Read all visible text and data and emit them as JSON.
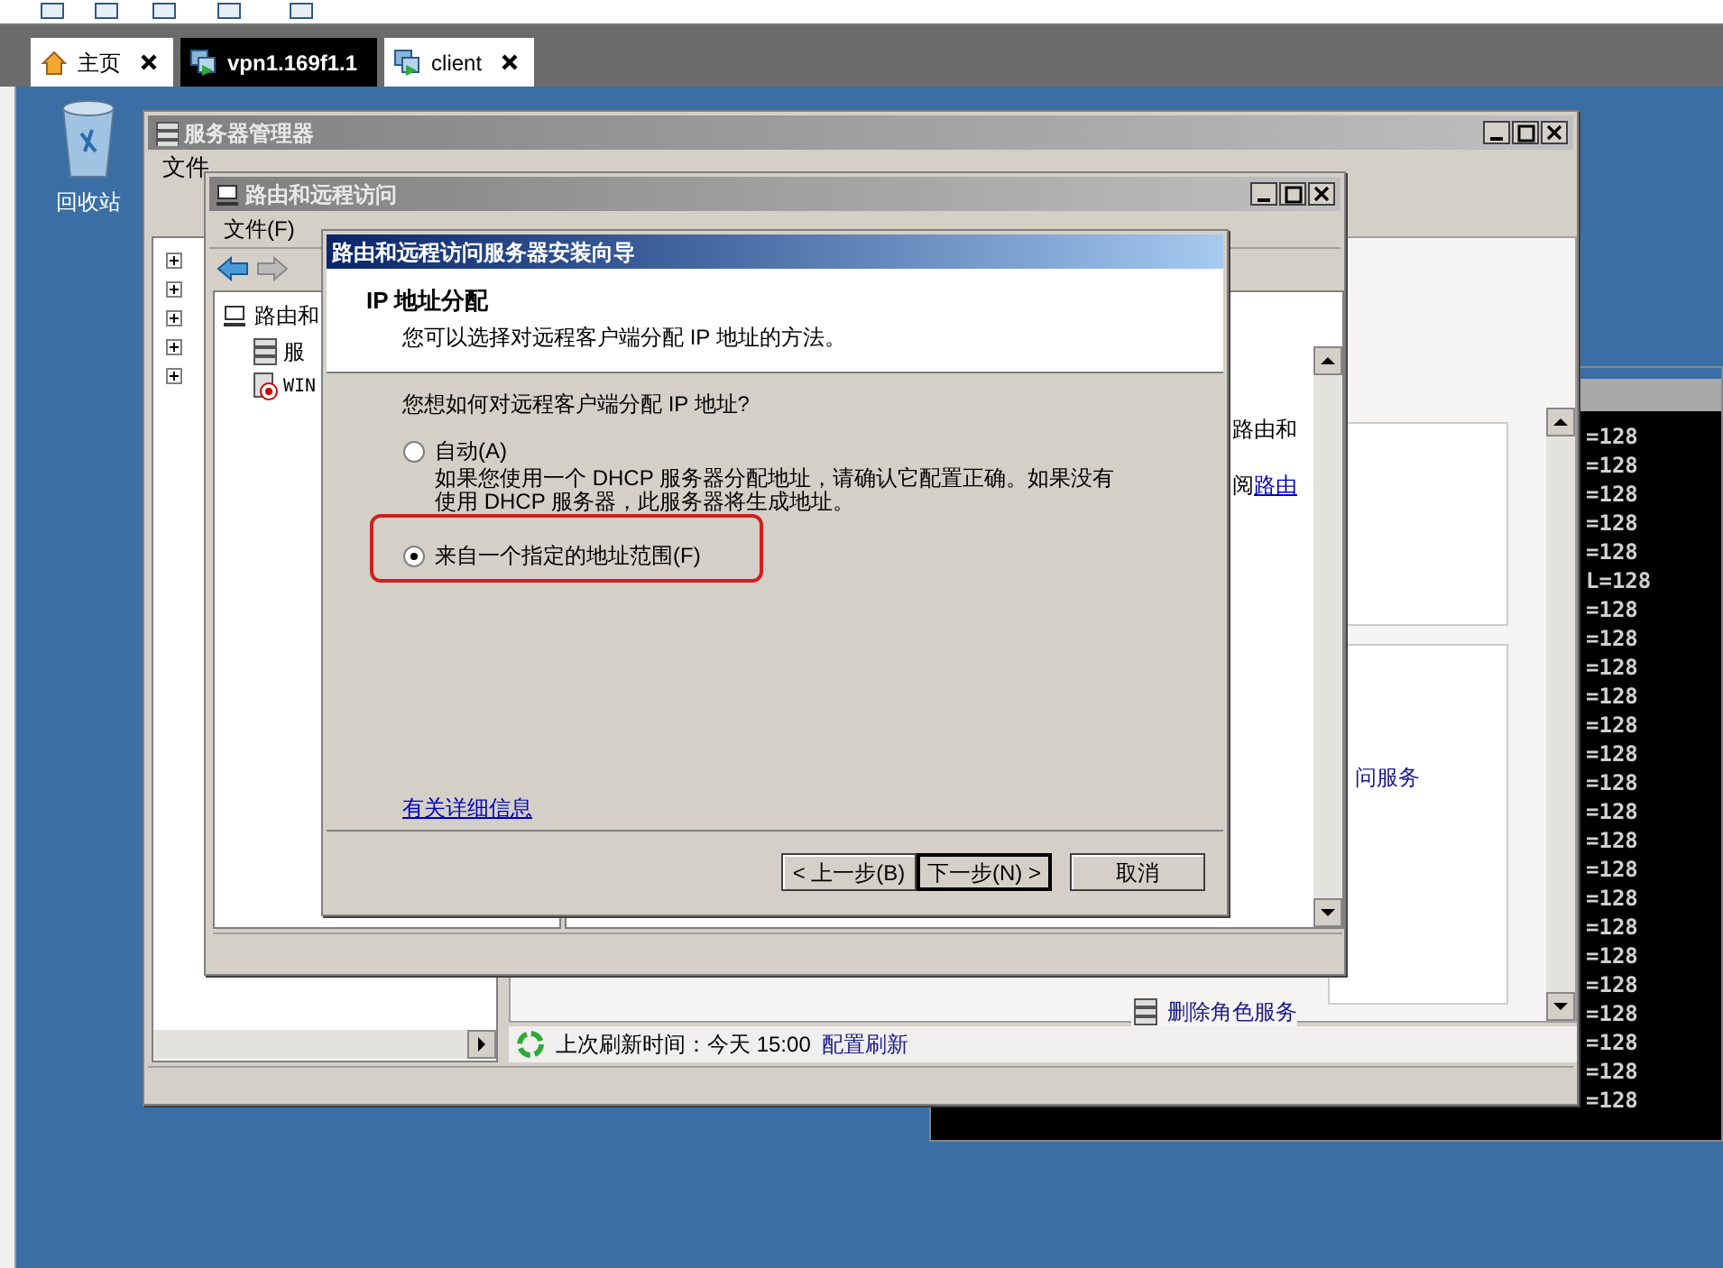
{
  "vm_tabs": [
    {
      "label": "主页",
      "kind": "home",
      "selected": false,
      "closable": true
    },
    {
      "label": "vpn1.169f1.1",
      "kind": "vm",
      "selected": true,
      "closable": false
    },
    {
      "label": "client",
      "kind": "vm",
      "selected": false,
      "closable": true
    }
  ],
  "desktop": {
    "icons": [
      {
        "label": "回收站"
      }
    ]
  },
  "console": {
    "lines": [
      "=128",
      "=128",
      "=128",
      "=128",
      "=128",
      "L=128",
      "=128",
      "=128",
      "=128",
      "=128",
      "=128",
      "=128",
      "=128",
      "=128",
      "=128",
      "=128",
      "=128",
      "=128",
      "=128",
      "=128",
      "=128",
      "=128",
      "=128",
      "=128"
    ]
  },
  "server_manager": {
    "title": "服务器管理器",
    "menu": [
      "文件"
    ],
    "link_text": "问服务",
    "role_action": "删除角色服务",
    "status": {
      "text": "上次刷新时间：今天 15:00",
      "link": "配置刷新"
    }
  },
  "rras": {
    "title": "路由和远程访问",
    "menu": [
      "文件(F)"
    ],
    "tree": [
      {
        "label": "路由和",
        "children": [
          {
            "label": "服",
            "kind": "server"
          },
          {
            "label": "WIN",
            "kind": "server-error"
          }
        ]
      }
    ],
    "pane_text": "路由和",
    "pane_text_2": "阅",
    "pane_link": "路由"
  },
  "wizard": {
    "title": "路由和远程访问服务器安装向导",
    "heading": "IP 地址分配",
    "subheading": "您可以选择对远程客户端分配 IP 地址的方法。",
    "question": "您想如何对远程客户端分配 IP 地址?",
    "options": [
      {
        "label": "自动(A)",
        "selected": false,
        "annotated": false,
        "description": "如果您使用一个 DHCP 服务器分配地址，请确认它配置正确。如果没有使用 DHCP 服务器，此服务器将生成地址。"
      },
      {
        "label": "来自一个指定的地址范围(F)",
        "selected": true,
        "annotated": true
      }
    ],
    "help_link": "有关详细信息",
    "buttons": [
      {
        "label": "< 上一步(B)",
        "is_default": false
      },
      {
        "label": "下一步(N) >",
        "is_default": true
      },
      {
        "label": "取消",
        "is_default": false
      }
    ]
  }
}
